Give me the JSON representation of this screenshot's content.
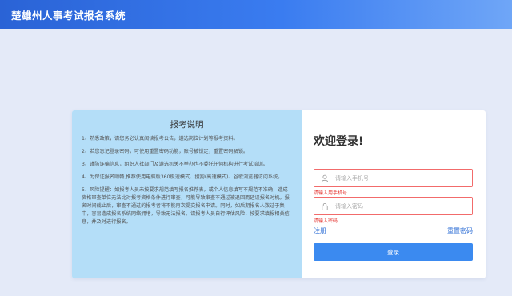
{
  "header": {
    "title": "楚雄州人事考试报名系统"
  },
  "notice": {
    "title": "报考说明",
    "items": [
      "1、熟悉政策，请您务必认真阅读报考公告，遴选岗位计划等报考资料。",
      "2、若您忘记登录密码，可使用重置密码功能，账号被锁定，重置密码解锁。",
      "3、谨防诈骗信息，组织人社部门及遴选机关不举办也不委托任何机构进行考试培训。",
      "4、为保证报名顺畅,推荐使用电脑版360极速模式、搜狗(高速模式)、谷歌浏览器访问系统。",
      "5、风险提醒：如报考人员未按要求规范填写报名推荐表，或个人信息填写不规范不准确，造成资格审查单位无法比对报考资格条件进行审查，可能导致审查不通过被退回而延误报名时机。报名时间截止后，审查不通过的报考者将不能再次提交报名申请。同时，如后期报名人数过于集中，容易造成报名系统网络拥堵，导致无法报名。请报考人员自行评估风险，按要求填报相关信息，并及时进行报名。"
    ]
  },
  "login": {
    "title": "欢迎登录!",
    "phone": {
      "placeholder": "请输入手机号",
      "value": "",
      "error": "请输入用手机号"
    },
    "password": {
      "placeholder": "请输入密码",
      "value": "",
      "error": "请输入密码"
    },
    "register_label": "注册",
    "reset_label": "重置密码",
    "submit_label": "登录"
  },
  "colors": {
    "accent": "#3b8af0",
    "error": "#e53935",
    "notice_bg": "#b4def8",
    "page_bg": "#e4eaf8"
  },
  "icons": {
    "phone_field": "user-icon",
    "password_field": "lock-icon"
  }
}
